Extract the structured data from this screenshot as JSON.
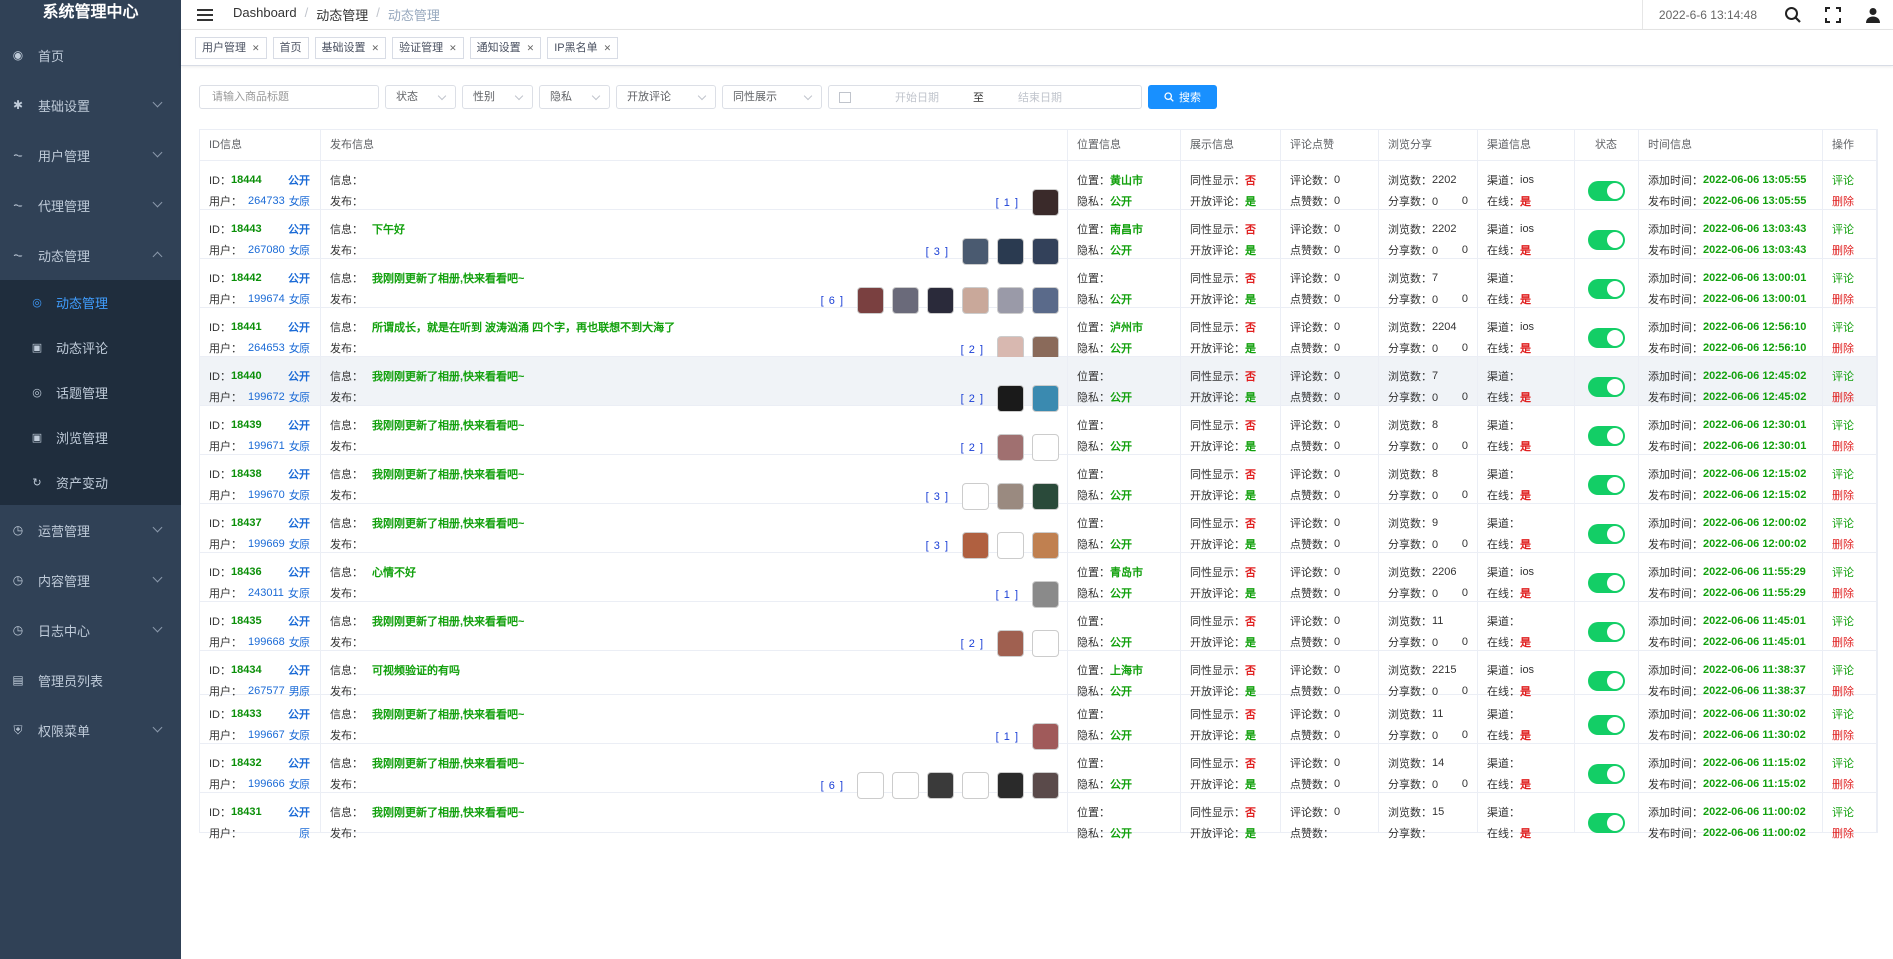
{
  "app_title": "系统管理中心",
  "sidebar": {
    "items": [
      {
        "key": "home",
        "label": "首页",
        "icon": "dashboard-icon",
        "expandable": false
      },
      {
        "key": "basic",
        "label": "基础设置",
        "icon": "gear-icon",
        "expandable": true
      },
      {
        "key": "users",
        "label": "用户管理",
        "icon": "chart-icon",
        "expandable": true
      },
      {
        "key": "agent",
        "label": "代理管理",
        "icon": "chart-icon",
        "expandable": true
      },
      {
        "key": "dynamic",
        "label": "动态管理",
        "icon": "chart-icon",
        "expandable": true,
        "open": true,
        "children": [
          {
            "label": "动态管理",
            "icon": "circle-dot-icon",
            "active": true
          },
          {
            "label": "动态评论",
            "icon": "doc-icon"
          },
          {
            "label": "话题管理",
            "icon": "circle-dot-icon"
          },
          {
            "label": "浏览管理",
            "icon": "doc-icon"
          },
          {
            "label": "资产变动",
            "icon": "refresh-icon"
          }
        ]
      },
      {
        "key": "ops",
        "label": "运营管理",
        "icon": "clock-icon",
        "expandable": true
      },
      {
        "key": "content",
        "label": "内容管理",
        "icon": "clock-icon",
        "expandable": true
      },
      {
        "key": "log",
        "label": "日志中心",
        "icon": "clock-icon",
        "expandable": true
      },
      {
        "key": "admins",
        "label": "管理员列表",
        "icon": "card-icon",
        "expandable": false
      },
      {
        "key": "perm",
        "label": "权限菜单",
        "icon": "shield-icon",
        "expandable": true
      }
    ]
  },
  "breadcrumb": [
    "Dashboard",
    "动态管理",
    "动态管理"
  ],
  "datetime": "2022-6-6 13:14:48",
  "tags": [
    "用户管理",
    "首页",
    "基础设置",
    "验证管理",
    "通知设置",
    "IP黑名单"
  ],
  "tags_closable": [
    true,
    false,
    true,
    true,
    true,
    true
  ],
  "filters": {
    "title_placeholder": "请输入商品标题",
    "selects": [
      "状态",
      "性别",
      "隐私",
      "开放评论",
      "同性展示"
    ],
    "date_start": "开始日期",
    "date_sep": "至",
    "date_end": "结束日期",
    "search_label": "搜索"
  },
  "columns": [
    "ID信息",
    "发布信息",
    "位置信息",
    "展示信息",
    "评论点赞",
    "浏览分享",
    "渠道信息",
    "状态",
    "时间信息",
    "操作"
  ],
  "labels": {
    "id": "ID：",
    "user": "用户：",
    "public": "公开",
    "orig": "原",
    "info": "信息：",
    "publish": "发布：",
    "loc": "位置：",
    "privacy": "隐私：",
    "same_show": "同性显示：",
    "open_comment": "开放评论：",
    "comments": "评论数：",
    "likes": "点赞数：",
    "views": "浏览数：",
    "shares": "分享数：",
    "channel": "渠道：",
    "online": "在线：",
    "added": "添加时间：",
    "published": "发布时间：",
    "op_comment": "评论",
    "op_delete": "删除",
    "no": "否",
    "yes": "是"
  },
  "rows": [
    {
      "id": "18444",
      "uid": "264733",
      "gender": "女",
      "msg": "",
      "loc": "黄山市",
      "comments": "0",
      "likes": "0",
      "views": "2202",
      "shares": "0",
      "shares_b": "0",
      "channel": "ios",
      "time": "2022-06-06 13:05:55",
      "img_count": "[ 1 ]",
      "imgs": [
        "#3a2a2a"
      ]
    },
    {
      "id": "18443",
      "uid": "267080",
      "gender": "女",
      "msg": "下午好",
      "loc": "南昌市",
      "comments": "0",
      "likes": "0",
      "views": "2202",
      "shares": "0",
      "shares_b": "0",
      "channel": "ios",
      "time": "2022-06-06 13:03:43",
      "img_count": "[ 3 ]",
      "imgs": [
        "#4a5a70",
        "#2a3a50",
        "#33415a"
      ]
    },
    {
      "id": "18442",
      "uid": "199674",
      "gender": "女",
      "msg": "我刚刚更新了相册,快来看看吧~",
      "loc": "",
      "comments": "0",
      "likes": "0",
      "views": "7",
      "shares": "0",
      "shares_b": "0",
      "channel": "",
      "time": "2022-06-06 13:00:01",
      "img_count": "[ 6 ]",
      "imgs": [
        "#7a4040",
        "#6a6a7a",
        "#2a2a3a",
        "#c9a89a",
        "#9a9aa8",
        "#5a6a8a"
      ]
    },
    {
      "id": "18441",
      "uid": "264653",
      "gender": "女",
      "msg": "所谓成长，就是在听到 波涛汹涌 四个字，再也联想不到大海了",
      "loc": "泸州市",
      "comments": "0",
      "likes": "0",
      "views": "2204",
      "shares": "0",
      "shares_b": "0",
      "channel": "ios",
      "time": "2022-06-06 12:56:10",
      "img_count": "[ 2 ]",
      "imgs": [
        "#d8b8b0",
        "#8a6a5a"
      ]
    },
    {
      "id": "18440",
      "uid": "199672",
      "gender": "女",
      "msg": "我刚刚更新了相册,快来看看吧~",
      "loc": "",
      "comments": "0",
      "likes": "0",
      "views": "7",
      "shares": "0",
      "shares_b": "0",
      "channel": "",
      "time": "2022-06-06 12:45:02",
      "img_count": "[ 2 ]",
      "imgs": [
        "#1a1a1a",
        "#3a8ab0"
      ],
      "hl": true
    },
    {
      "id": "18439",
      "uid": "199671",
      "gender": "女",
      "msg": "我刚刚更新了相册,快来看看吧~",
      "loc": "",
      "comments": "0",
      "likes": "0",
      "views": "8",
      "shares": "0",
      "shares_b": "0",
      "channel": "",
      "time": "2022-06-06 12:30:01",
      "img_count": "[ 2 ]",
      "imgs": [
        "#a07070",
        "#ffffff"
      ]
    },
    {
      "id": "18438",
      "uid": "199670",
      "gender": "女",
      "msg": "我刚刚更新了相册,快来看看吧~",
      "loc": "",
      "comments": "0",
      "likes": "0",
      "views": "8",
      "shares": "0",
      "shares_b": "0",
      "channel": "",
      "time": "2022-06-06 12:15:02",
      "img_count": "[ 3 ]",
      "imgs": [
        "#ffffff",
        "#9a8a80",
        "#2a4a3a"
      ]
    },
    {
      "id": "18437",
      "uid": "199669",
      "gender": "女",
      "msg": "我刚刚更新了相册,快来看看吧~",
      "loc": "",
      "comments": "0",
      "likes": "0",
      "views": "9",
      "shares": "0",
      "shares_b": "0",
      "channel": "",
      "time": "2022-06-06 12:00:02",
      "img_count": "[ 3 ]",
      "imgs": [
        "#b06040",
        "#ffffff",
        "#c08050"
      ]
    },
    {
      "id": "18436",
      "uid": "243011",
      "gender": "女",
      "msg": "心情不好",
      "loc": "青岛市",
      "comments": "0",
      "likes": "0",
      "views": "2206",
      "shares": "0",
      "shares_b": "0",
      "channel": "ios",
      "time": "2022-06-06 11:55:29",
      "img_count": "[ 1 ]",
      "imgs": [
        "#8a8a8a"
      ]
    },
    {
      "id": "18435",
      "uid": "199668",
      "gender": "女",
      "msg": "我刚刚更新了相册,快来看看吧~",
      "loc": "",
      "comments": "0",
      "likes": "0",
      "views": "11",
      "shares": "0",
      "shares_b": "0",
      "channel": "",
      "time": "2022-06-06 11:45:01",
      "img_count": "[ 2 ]",
      "imgs": [
        "#a06050",
        "#ffffff"
      ]
    },
    {
      "id": "18434",
      "uid": "267577",
      "gender": "男",
      "msg": "可视频验证的有吗",
      "loc": "上海市",
      "comments": "0",
      "likes": "0",
      "views": "2215",
      "shares": "0",
      "shares_b": "0",
      "channel": "ios",
      "time": "2022-06-06 11:38:37",
      "img_count": "",
      "imgs": []
    },
    {
      "id": "18433",
      "uid": "199667",
      "gender": "女",
      "msg": "我刚刚更新了相册,快来看看吧~",
      "loc": "",
      "comments": "0",
      "likes": "0",
      "views": "11",
      "shares": "0",
      "shares_b": "0",
      "channel": "",
      "time": "2022-06-06 11:30:02",
      "img_count": "[ 1 ]",
      "imgs": [
        "#a05a5a"
      ]
    },
    {
      "id": "18432",
      "uid": "199666",
      "gender": "女",
      "msg": "我刚刚更新了相册,快来看看吧~",
      "loc": "",
      "comments": "0",
      "likes": "0",
      "views": "14",
      "shares": "0",
      "shares_b": "0",
      "channel": "",
      "time": "2022-06-06 11:15:02",
      "img_count": "[ 6 ]",
      "imgs": [
        "#ffffff",
        "#ffffff",
        "#3a3a3a",
        "#ffffff",
        "#2a2a2a",
        "#5a4a4a"
      ]
    },
    {
      "id": "18431",
      "uid": "",
      "gender": "",
      "msg": "我刚刚更新了相册,快来看看吧~",
      "loc": "",
      "comments": "0",
      "likes": "",
      "views": "15",
      "shares": "",
      "shares_b": "",
      "channel": "",
      "time": "2022-06-06 11:00:02",
      "img_count": "",
      "imgs": []
    }
  ]
}
